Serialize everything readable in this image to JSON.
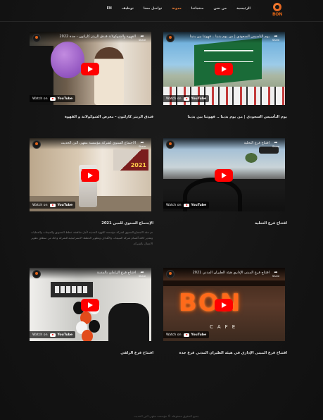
{
  "header": {
    "logo_text": "BON",
    "nav": [
      {
        "label": "الرئيسية",
        "active": false
      },
      {
        "label": "من نحن",
        "active": false
      },
      {
        "label": "منتجاتنا",
        "active": false
      },
      {
        "label": "مدونة",
        "active": true
      },
      {
        "label": "تواصل معنا",
        "active": false
      },
      {
        "label": "توظيف",
        "active": false
      },
      {
        "label": "EN",
        "active": false
      }
    ]
  },
  "videos": [
    {
      "title": "يوم التأسيس السعودي | من يوم بدينا .. فهوتنا بين يدينا",
      "caption": "يوم التأسيس السعودي | من يوم بدينا .. فهوتنا بين يدينا",
      "share": "Share",
      "watch_on": "Watch on",
      "youtube": "YouTube"
    },
    {
      "title": "القهوة والشوكولاتة فندق الريتز كارلتون - جدة 2022",
      "caption": "فندق الريتز كارلتون - معرض الشوكولاتة و القهوة",
      "share": "Share",
      "watch_on": "Watch on",
      "youtube": "YouTube"
    },
    {
      "title": "افتتاح فرع التحلية",
      "caption": "افتتاح فرع التحلية",
      "share": "Share",
      "watch_on": "Watch on",
      "youtube": "YouTube"
    },
    {
      "title": "الاجتماع السنوي لشركة مؤسسة مقهى البن الحديث",
      "caption": "الإجتماع السنوي للمبن 2021",
      "description": "تم عقد الاجتماع السنوي لشركة مؤسسة القهوة الحديثة لأجل مناقشة خطط التسويق والمبيعات والعمليات وتقدير كافة أقسام شركة المبيعات والأهداف وتطوير الخطط الاستراتيجية للشركة وذلك من منطلق تطوير الاعمال بالشركة.",
      "badge": "2021",
      "share": "Share",
      "watch_on": "Watch on",
      "youtube": "YouTube"
    },
    {
      "title": "افتتاح فرع المبنى الإداري هيئة الطيران المدني 2021",
      "caption": "افتتاح فرع المبنى الإداري في هيئة الطيران المدني فرع جدة",
      "share": "Share",
      "watch_on": "Watch on",
      "youtube": "YouTube"
    },
    {
      "title": "افتتاح فرع الزاملي بالمدينة",
      "caption": "افتتاح فرع الزلفي",
      "share": "Share",
      "watch_on": "Watch on",
      "youtube": "YouTube"
    }
  ],
  "thumb_text": {
    "bon": "BON",
    "cafe": "CAFE"
  },
  "footer": {
    "text": "جميع الحقوق محفوظة © مؤسسة مقهى البن الحديث"
  },
  "colors": {
    "accent": "#e77b35",
    "play": "#ff0000"
  }
}
